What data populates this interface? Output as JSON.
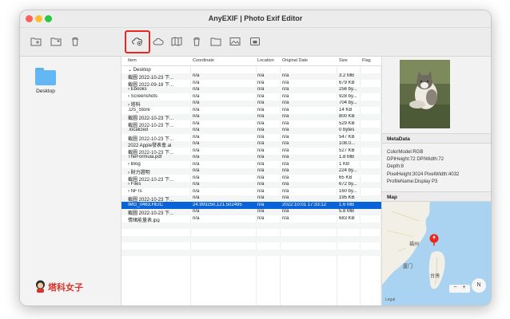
{
  "window": {
    "title": "AnyEXIF | Photo Exif Editor"
  },
  "sidebar": {
    "folder_label": "Desktop",
    "brand": "塔科女子"
  },
  "columns": [
    "Item",
    "Coordinate",
    "Location",
    "Original Date",
    "Size",
    "Flag"
  ],
  "rows": [
    {
      "item": "⌄ Desktop",
      "coord": "",
      "loc": "",
      "date": "",
      "size": ""
    },
    {
      "item": "截圖 2022-10-23 下...",
      "coord": "n/a",
      "loc": "n/a",
      "date": "n/a",
      "size": "3.2 MB"
    },
    {
      "item": "截圖 2022-09-18 下...",
      "coord": "n/a",
      "loc": "n/a",
      "date": "n/a",
      "size": "679 KB"
    },
    {
      "item": "› Ebooks",
      "coord": "n/a",
      "loc": "n/a",
      "date": "n/a",
      "size": "256 by..."
    },
    {
      "item": "› Screenshots",
      "coord": "n/a",
      "loc": "n/a",
      "date": "n/a",
      "size": "928 by..."
    },
    {
      "item": "› 塔科",
      "coord": "n/a",
      "loc": "n/a",
      "date": "n/a",
      "size": "704 by..."
    },
    {
      "item": ".DS_Store",
      "coord": "n/a",
      "loc": "n/a",
      "date": "n/a",
      "size": "14 KB"
    },
    {
      "item": "截圖 2022-10-23 下...",
      "coord": "n/a",
      "loc": "n/a",
      "date": "n/a",
      "size": "800 KB"
    },
    {
      "item": "截圖 2022-10-23 下...",
      "coord": "n/a",
      "loc": "n/a",
      "date": "n/a",
      "size": "529 KB"
    },
    {
      "item": ".localized",
      "coord": "n/a",
      "loc": "n/a",
      "date": "n/a",
      "size": "0 bytes"
    },
    {
      "item": "截圖 2022-10-23 下...",
      "coord": "n/a",
      "loc": "n/a",
      "date": "n/a",
      "size": "547 KB"
    },
    {
      "item": "2022 Apple發表會.ai",
      "coord": "n/a",
      "loc": "n/a",
      "date": "n/a",
      "size": "108.0..."
    },
    {
      "item": "截圖 2022-10-23 下...",
      "coord": "n/a",
      "loc": "n/a",
      "date": "n/a",
      "size": "527 KB"
    },
    {
      "item": "TheFormula.pdf",
      "coord": "n/a",
      "loc": "n/a",
      "date": "n/a",
      "size": "1.8 MB"
    },
    {
      "item": "› Blog",
      "coord": "n/a",
      "loc": "n/a",
      "date": "n/a",
      "size": "1 KB"
    },
    {
      "item": "› 財力證明",
      "coord": "n/a",
      "loc": "n/a",
      "date": "n/a",
      "size": "224 by..."
    },
    {
      "item": "截圖 2022-10-23 下...",
      "coord": "n/a",
      "loc": "n/a",
      "date": "n/a",
      "size": "65 KB"
    },
    {
      "item": "› Files",
      "coord": "n/a",
      "loc": "n/a",
      "date": "n/a",
      "size": "672 by..."
    },
    {
      "item": "› NFTs",
      "coord": "n/a",
      "loc": "n/a",
      "date": "n/a",
      "size": "160 by..."
    },
    {
      "item": "截圖 2022-10-23 下...",
      "coord": "n/a",
      "loc": "n/a",
      "date": "n/a",
      "size": "195 KB"
    },
    {
      "item": "IMG_0463.HEIC",
      "coord": "24.993250,121.502495",
      "loc": "n/a",
      "date": "2022:10:01 17:33:12",
      "size": "1.6 MB",
      "selected": true
    },
    {
      "item": "截圖 2022-10-23 下...",
      "coord": "n/a",
      "loc": "n/a",
      "date": "n/a",
      "size": "5.8 MB"
    },
    {
      "item": "情緒能量表.jpg",
      "coord": "n/a",
      "loc": "n/a",
      "date": "n/a",
      "size": "683 KB"
    }
  ],
  "metadata": {
    "heading": "MetaData",
    "line1": "ColorModel:RGB",
    "line2": "DPIHeight:72  DPIWidth:72",
    "line3": "Depth:8",
    "line4": "PixelHeight:3024  PixelWidth:4032",
    "line5": "ProfileName:Display P3"
  },
  "map": {
    "heading": "Map",
    "city1": "福州",
    "city2": "厦门",
    "city3": "台灣",
    "zoom_minus": "−",
    "zoom_plus": "+",
    "compass": "N",
    "legal": "Legal"
  },
  "colors": {
    "selection": "#0b63d8",
    "highlight": "#e8281f",
    "folder": "#63b8f3"
  }
}
